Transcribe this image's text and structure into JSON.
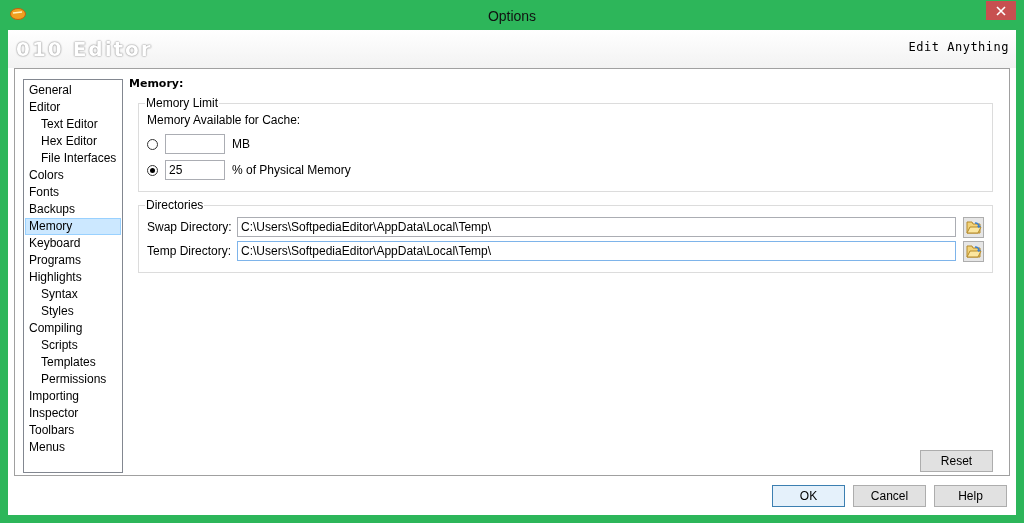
{
  "window": {
    "title": "Options"
  },
  "header": {
    "logo": "010 Editor",
    "tagline": "Edit Anything"
  },
  "sidebar": {
    "items": [
      {
        "label": "General",
        "selected": false
      },
      {
        "label": "Editor",
        "selected": false,
        "children": [
          {
            "label": "Text Editor",
            "selected": false
          },
          {
            "label": "Hex Editor",
            "selected": false
          },
          {
            "label": "File Interfaces",
            "selected": false
          }
        ]
      },
      {
        "label": "Colors",
        "selected": false
      },
      {
        "label": "Fonts",
        "selected": false
      },
      {
        "label": "Backups",
        "selected": false
      },
      {
        "label": "Memory",
        "selected": true
      },
      {
        "label": "Keyboard",
        "selected": false
      },
      {
        "label": "Programs",
        "selected": false
      },
      {
        "label": "Highlights",
        "selected": false,
        "children": [
          {
            "label": "Syntax",
            "selected": false
          },
          {
            "label": "Styles",
            "selected": false
          }
        ]
      },
      {
        "label": "Compiling",
        "selected": false,
        "children": [
          {
            "label": "Scripts",
            "selected": false
          },
          {
            "label": "Templates",
            "selected": false
          },
          {
            "label": "Permissions",
            "selected": false
          }
        ]
      },
      {
        "label": "Importing",
        "selected": false
      },
      {
        "label": "Inspector",
        "selected": false
      },
      {
        "label": "Toolbars",
        "selected": false
      },
      {
        "label": "Menus",
        "selected": false
      }
    ]
  },
  "page": {
    "heading": "Memory:",
    "memory_limit": {
      "legend": "Memory Limit",
      "label": "Memory Available for Cache:",
      "options": [
        {
          "selected": false,
          "unit": "MB"
        },
        {
          "selected": true,
          "value": "25",
          "unit": "% of Physical Memory"
        }
      ]
    },
    "directories": {
      "legend": "Directories",
      "fields": [
        {
          "label": "Swap Directory:",
          "value": "C:\\Users\\SoftpediaEditor\\AppData\\Local\\Temp\\",
          "focused": false
        },
        {
          "label": "Temp Directory:",
          "value": "C:\\Users\\SoftpediaEditor\\AppData\\Local\\Temp\\",
          "focused": true
        }
      ]
    },
    "reset_button": "Reset"
  },
  "buttons": [
    {
      "label": "OK",
      "default": true
    },
    {
      "label": "Cancel",
      "default": false
    },
    {
      "label": "Help",
      "default": false
    }
  ]
}
